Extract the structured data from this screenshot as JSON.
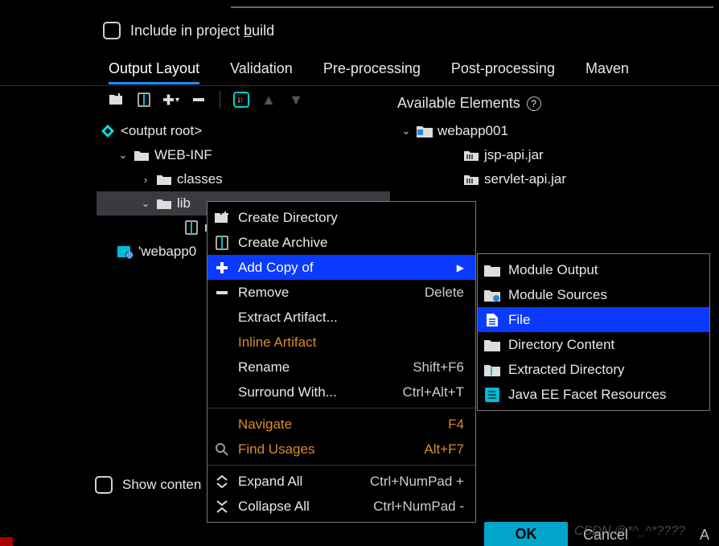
{
  "include_label_pre": "Include in project ",
  "include_label_hot": "b",
  "include_label_post": "uild",
  "tabs": {
    "output_layout": "Output Layout",
    "validation": "Validation",
    "pre_processing": "Pre-processing",
    "post_processing": "Post-processing",
    "maven": "Maven"
  },
  "tree": {
    "output_root": "<output root>",
    "web_inf": "WEB-INF",
    "classes": "classes",
    "lib": "lib",
    "my": "my",
    "webapp_trunc": "'webapp0"
  },
  "available_header": "Available Elements",
  "right_tree": {
    "project": "webapp001",
    "jsp": "jsp-api.jar",
    "servlet": "servlet-api.jar"
  },
  "menu": {
    "create_dir": "Create Directory",
    "create_archive": "Create Archive",
    "add_copy": "Add Copy of",
    "remove": "Remove",
    "remove_sc": "Delete",
    "extract": "Extract Artifact...",
    "inline": "Inline Artifact",
    "rename": "Rename",
    "rename_sc": "Shift+F6",
    "surround": "Surround With...",
    "surround_sc": "Ctrl+Alt+T",
    "navigate": "Navigate",
    "navigate_sc": "F4",
    "find_usages": "Find Usages",
    "find_usages_sc": "Alt+F7",
    "expand_all": "Expand All",
    "expand_all_sc": "Ctrl+NumPad +",
    "collapse_all": "Collapse All",
    "collapse_all_sc": "Ctrl+NumPad -"
  },
  "submenu": {
    "module_output": "Module Output",
    "module_sources": "Module Sources",
    "file": "File",
    "dir_content": "Directory Content",
    "extracted_dir": "Extracted Directory",
    "java_ee": "Java EE Facet Resources"
  },
  "checkbox2_label": "Show conten",
  "buttons": {
    "ok": "OK",
    "cancel": "Cancel",
    "apply": "A"
  },
  "watermark": "CSDN @*^_^*????"
}
